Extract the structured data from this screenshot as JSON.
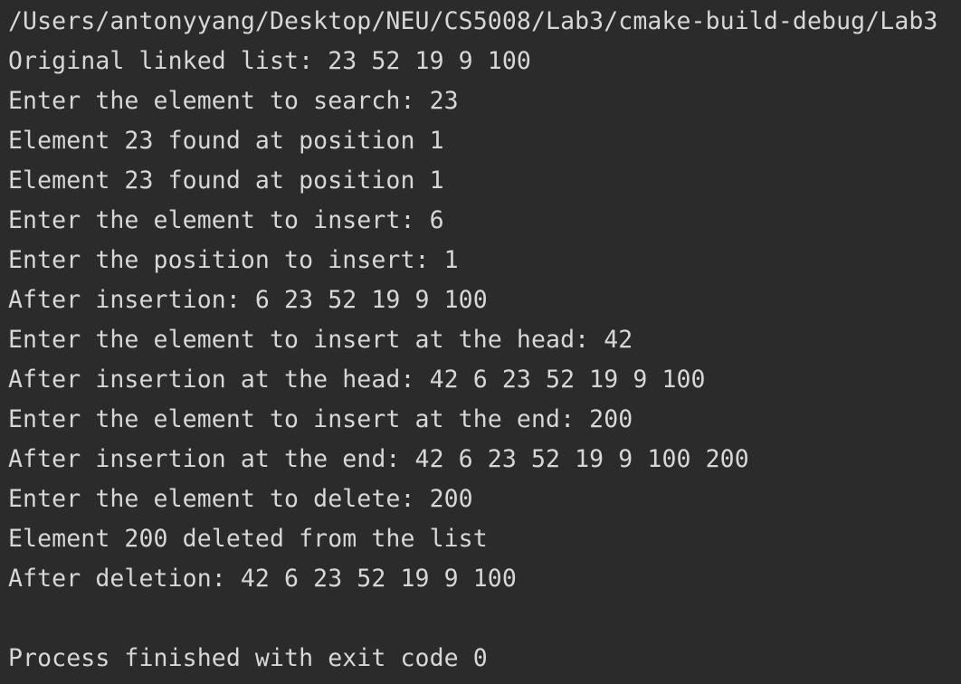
{
  "console": {
    "lines": [
      "/Users/antonyyang/Desktop/NEU/CS5008/Lab3/cmake-build-debug/Lab3",
      "Original linked list: 23 52 19 9 100",
      "Enter the element to search: 23",
      "Element 23 found at position 1",
      "Element 23 found at position 1",
      "Enter the element to insert: 6",
      "Enter the position to insert: 1",
      "After insertion: 6 23 52 19 9 100",
      "Enter the element to insert at the head: 42",
      "After insertion at the head: 42 6 23 52 19 9 100",
      "Enter the element to insert at the end: 200",
      "After insertion at the end: 42 6 23 52 19 9 100 200",
      "Enter the element to delete: 200",
      "Element 200 deleted from the list",
      "After deletion: 42 6 23 52 19 9 100",
      "",
      "Process finished with exit code 0"
    ]
  },
  "colors": {
    "background": "#2b2b2b",
    "text": "#d7d7d7"
  }
}
